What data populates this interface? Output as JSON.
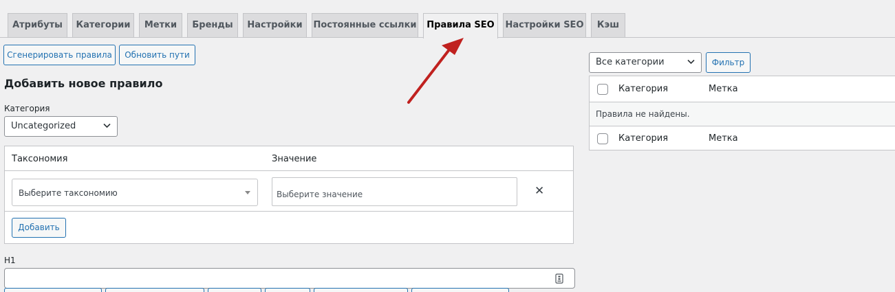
{
  "tabs": [
    {
      "label": "Атрибуты",
      "active": false
    },
    {
      "label": "Категории",
      "active": false
    },
    {
      "label": "Метки",
      "active": false
    },
    {
      "label": "Бренды",
      "active": false
    },
    {
      "label": "Настройки",
      "active": false
    },
    {
      "label": "Постоянные ссылки",
      "active": false
    },
    {
      "label": "Правила SEO",
      "active": true
    },
    {
      "label": "Настройки SEO",
      "active": false
    },
    {
      "label": "Кэш",
      "active": false
    }
  ],
  "toolbar": {
    "generate_label": "Сгенерировать правила",
    "update_paths_label": "Обновить пути"
  },
  "form": {
    "heading": "Добавить новое правило",
    "category_label": "Категория",
    "category_value": "Uncategorized",
    "taxonomy_header": "Таксономия",
    "value_header": "Значение",
    "taxonomy_placeholder": "Выберите таксономию",
    "value_placeholder": "Выберите значение",
    "add_label": "Добавить",
    "h1_label": "H1",
    "h1_value": ""
  },
  "filter": {
    "category_select": "Все категории",
    "filter_label": "Фильтр"
  },
  "rules_table": {
    "col_category": "Категория",
    "col_tag": "Метка",
    "empty_message": "Правила не найдены."
  },
  "colors": {
    "accent": "#2271b1",
    "annotation_arrow": "#c0211f"
  },
  "icons": {
    "chevron": "chevron-down-icon",
    "remove": "close-icon",
    "field": "variable-list-icon"
  }
}
